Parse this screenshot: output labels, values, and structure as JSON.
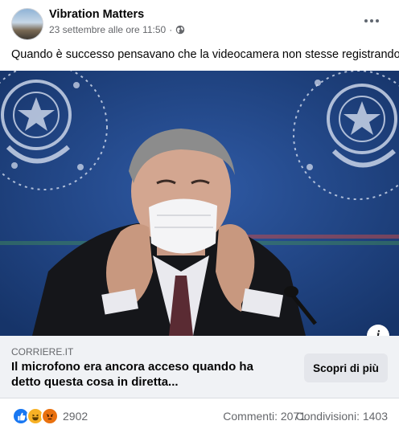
{
  "post": {
    "page_name": "Vibration Matters",
    "timestamp": "23 settembre alle ore 11:50",
    "separator": "·",
    "privacy_icon": "globe-icon",
    "more_icon": "more-options-icon",
    "text": "Quando è successo pensavano che la videocamera non stesse registrando"
  },
  "link_preview": {
    "domain": "CORRIERE.IT",
    "title": "Il microfono era ancora acceso quando ha detto questa cosa in diretta...",
    "cta_label": "Scopri di più",
    "info_icon_glyph": "i"
  },
  "stats": {
    "reaction_icons": [
      "like-icon",
      "haha-icon",
      "angry-icon"
    ],
    "reaction_count": "2902",
    "comments": "Commenti: 2071",
    "shares": "Condivisioni: 1403"
  },
  "colors": {
    "like": "#1877f2",
    "haha": "#f7b125",
    "angry": "#e9710f",
    "photo_background": "#1d3f7c"
  }
}
